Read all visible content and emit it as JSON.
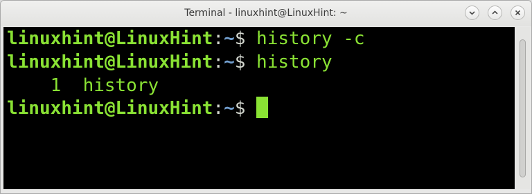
{
  "window": {
    "title": "Terminal - linuxhint@LinuxHint: ~",
    "buttons": [
      "minimize",
      "maximize",
      "close"
    ]
  },
  "terminal": {
    "lines": [
      {
        "user_host": "linuxhint@LinuxHint",
        "colon": ":",
        "path": "~",
        "dollar": "$ ",
        "command": "history -c"
      },
      {
        "user_host": "linuxhint@LinuxHint",
        "colon": ":",
        "path": "~",
        "dollar": "$ ",
        "command": "history"
      },
      {
        "output": "    1  history"
      },
      {
        "user_host": "linuxhint@LinuxHint",
        "colon": ":",
        "path": "~",
        "dollar": "$ ",
        "command": ""
      }
    ]
  },
  "colors": {
    "prompt_green": "#8ae234",
    "path_blue": "#729fcf",
    "background": "#000000"
  }
}
